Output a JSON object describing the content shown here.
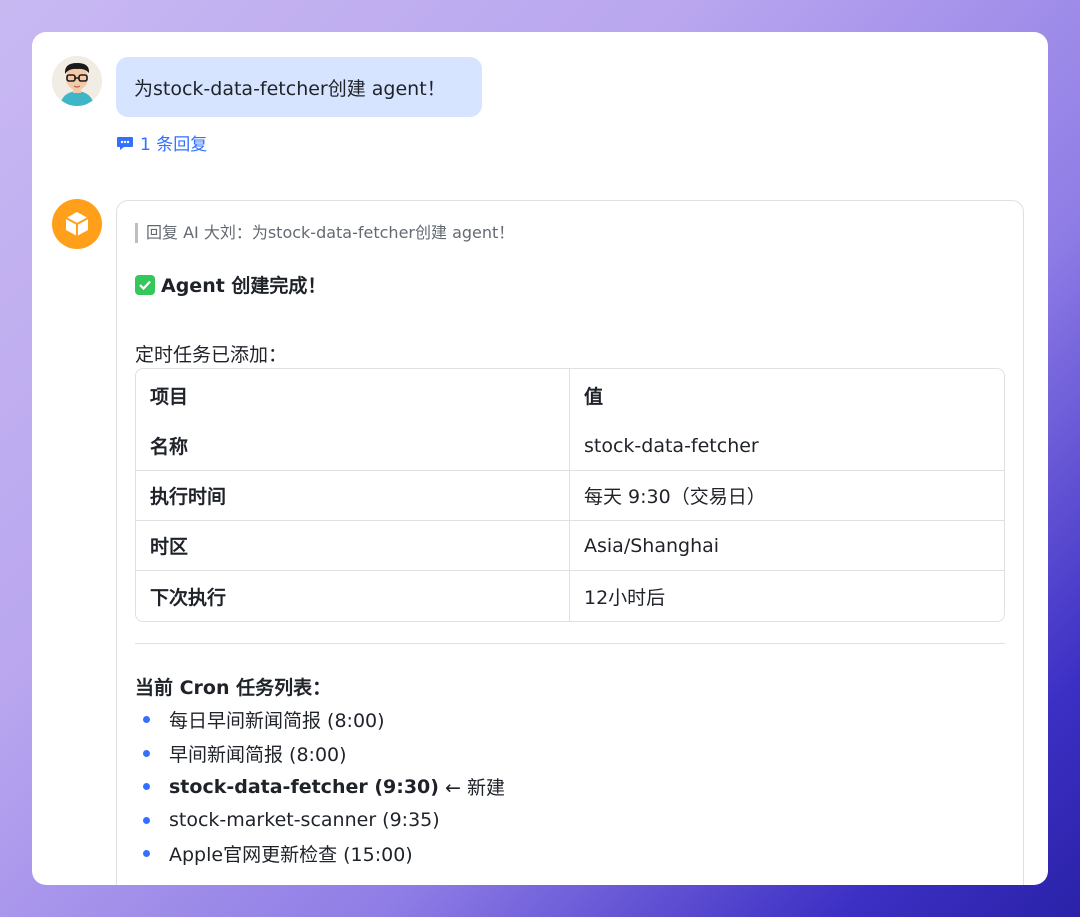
{
  "user_message": {
    "text": "为stock-data-fetcher创建 agent！",
    "reply_count": "1 条回复"
  },
  "bot_message": {
    "quote": "回复 AI 大刘：为stock-data-fetcher创建 agent！",
    "done_title": "Agent 创建完成！",
    "task_added_label": "定时任务已添加：",
    "table": {
      "headers": [
        "项目",
        "值"
      ],
      "rows": [
        [
          "名称",
          "stock-data-fetcher"
        ],
        [
          "执行时间",
          "每天 9:30（交易日）"
        ],
        [
          "时区",
          "Asia/Shanghai"
        ],
        [
          "下次执行",
          "12小时后"
        ]
      ]
    },
    "cron_title": "当前 Cron 任务列表：",
    "cron_items": [
      {
        "text": "每日早间新闻简报 (8:00)",
        "suffix": ""
      },
      {
        "text": "早间新闻简报 (8:00)",
        "suffix": ""
      },
      {
        "text": "stock-data-fetcher (9:30)",
        "suffix": " ← 新建"
      },
      {
        "text": "stock-market-scanner (9:35)",
        "suffix": ""
      },
      {
        "text": "Apple官网更新检查 (15:00)",
        "suffix": ""
      }
    ]
  },
  "colors": {
    "accent": "#3370ff",
    "bubble": "#d6e4ff",
    "bot_avatar": "#ff9f1a",
    "check": "#34c759"
  }
}
